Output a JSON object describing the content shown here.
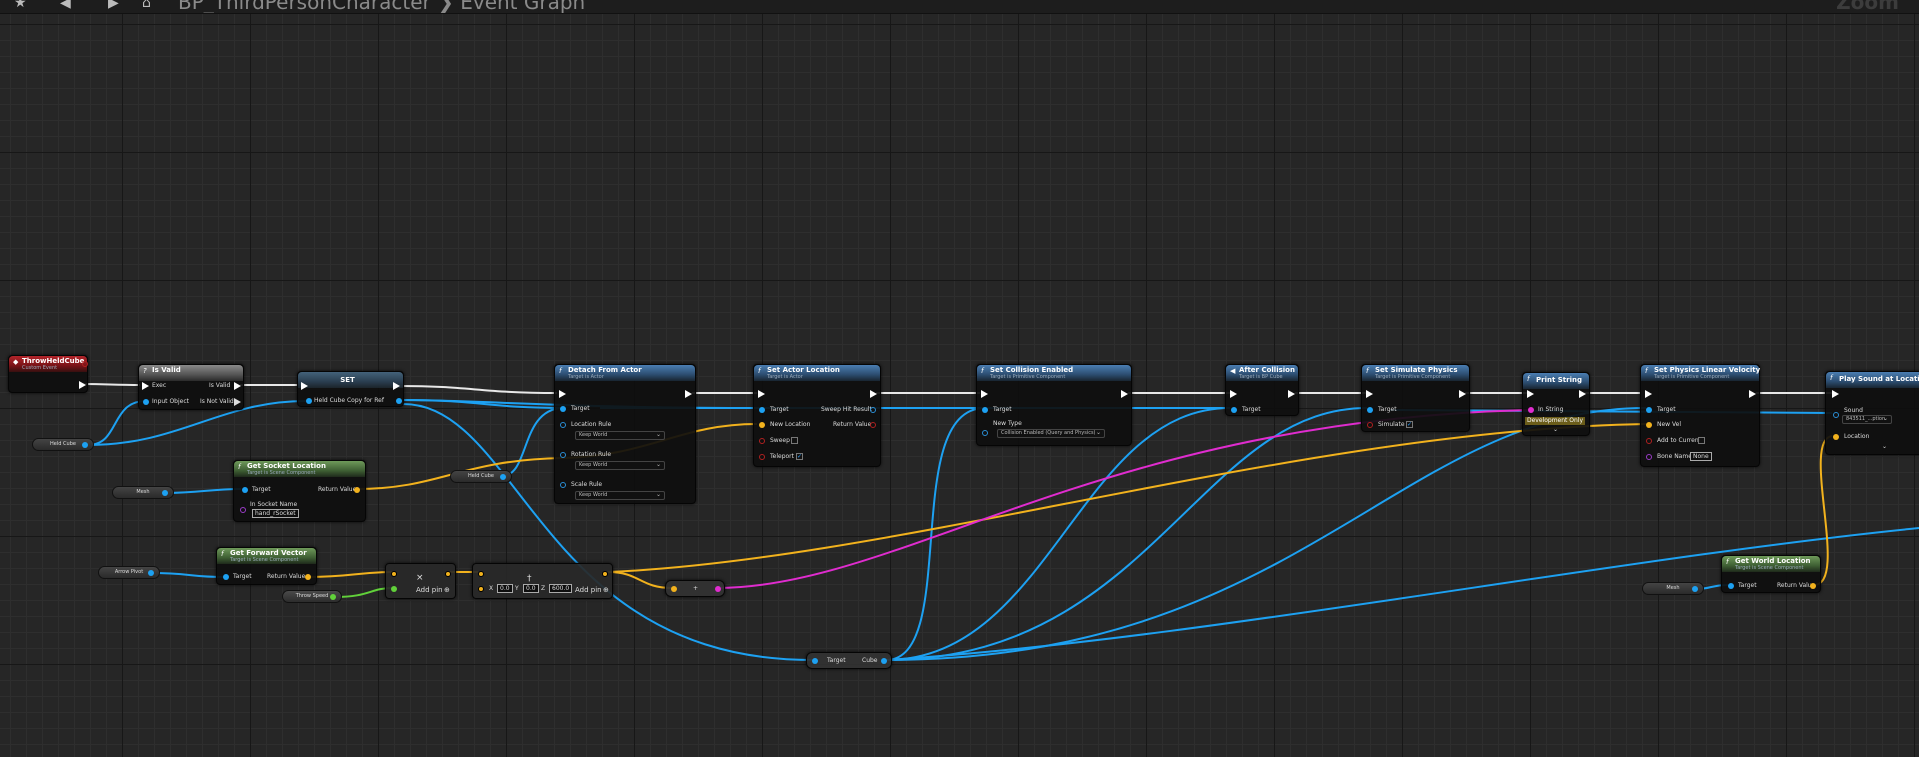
{
  "toolbar": {
    "breadcrumb": "BP_ThirdPersonCharacter  ❯  Event Graph",
    "zoom": "Zoom"
  },
  "nodes": {
    "throw": {
      "title": "ThrowHeldCube",
      "subtitle": "Custom Event"
    },
    "isvalid": {
      "title": "Is Valid",
      "exec": "Exec",
      "input": "Input Object",
      "isvalid": "Is Valid",
      "notvalid": "Is Not Valid"
    },
    "set": {
      "title": "SET",
      "pin": "Held Cube Copy for Ref"
    },
    "detach": {
      "title": "Detach From Actor",
      "subtitle": "Target is Actor",
      "target": "Target",
      "locrule": "Location Rule",
      "rotrule": "Rotation Rule",
      "scalerule": "Scale Rule",
      "keep": "Keep World"
    },
    "setloc": {
      "title": "Set Actor Location",
      "subtitle": "Target is Actor",
      "target": "Target",
      "newloc": "New Location",
      "sweep": "Sweep",
      "teleport": "Teleport",
      "sweephit": "Sweep Hit Result",
      "ret": "Return Value"
    },
    "collision": {
      "title": "Set Collision Enabled",
      "subtitle": "Target is Primitive Component",
      "target": "Target",
      "newtype": "New Type",
      "value": "Collision Enabled (Query and Physics)"
    },
    "after": {
      "title": "After Collision",
      "subtitle": "Target is BP Cube",
      "target": "Target"
    },
    "simulate": {
      "title": "Set Simulate Physics",
      "subtitle": "Target is Primitive Component",
      "target": "Target",
      "simulate": "Simulate"
    },
    "print": {
      "title": "Print String",
      "instring": "In String",
      "dev": "Development Only"
    },
    "velocity": {
      "title": "Set Physics Linear Velocity",
      "subtitle": "Target is Primitive Component",
      "target": "Target",
      "newvel": "New Vel",
      "add": "Add to Current",
      "bone": "Bone Name",
      "bonevalue": "None"
    },
    "sound": {
      "title": "Play Sound at Location",
      "sound": "Sound",
      "soundvalue": "843511_...ption",
      "location": "Location"
    },
    "socket": {
      "title": "Get Socket Location",
      "subtitle": "Target is Scene Component",
      "target": "Target",
      "insocket": "In Socket Name",
      "socketvalue": "hand_rSocket",
      "ret": "Return Value"
    },
    "forward": {
      "title": "Get Forward Vector",
      "subtitle": "Target is Scene Component",
      "target": "Target",
      "ret": "Return Value"
    },
    "worldloc": {
      "title": "Get World Location",
      "subtitle": "Target is Scene Component",
      "target": "Target",
      "ret": "Return Value"
    },
    "multiply": {
      "sym": "×",
      "addpin": "Add pin"
    },
    "multiply2": {
      "x": "0.0",
      "y": "0.0",
      "z": "600.0",
      "addpin": "Add pin"
    },
    "add": {
      "sym": "+"
    },
    "cast": {
      "target": "Target",
      "cube": "Cube"
    }
  },
  "vars": {
    "heldcube1": "Held Cube",
    "heldcube2": "Held Cube",
    "mesh1": "Mesh",
    "mesh2": "Mesh",
    "arrow": "Arrow Pivot",
    "speed": "Throw Speed"
  },
  "colors": {
    "exec": "#ffffff",
    "object": "#1da1f2",
    "vector": "#f2b21d",
    "string": "#e02ccf",
    "float": "#61d13a"
  }
}
